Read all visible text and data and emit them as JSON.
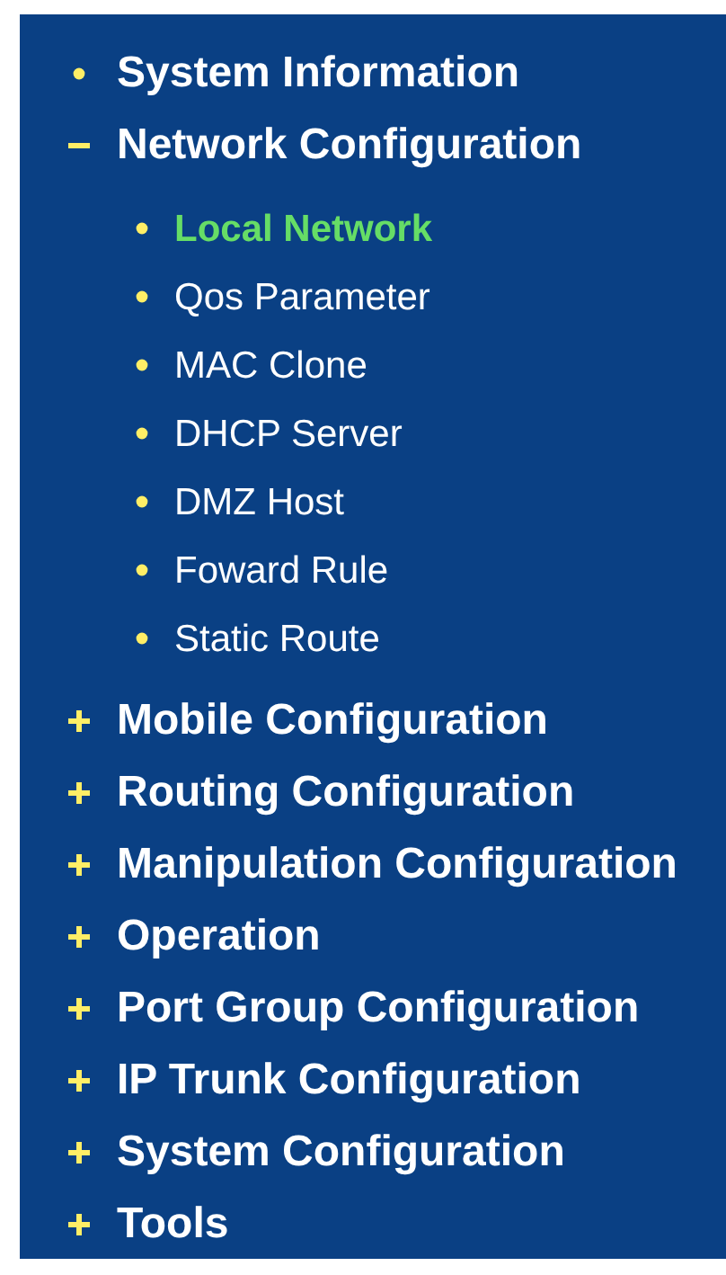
{
  "menu": {
    "items": [
      {
        "label": "System Information",
        "kind": "leaf",
        "selected": false
      },
      {
        "label": "Network Configuration",
        "kind": "group",
        "expanded": true,
        "selected": false,
        "children": [
          {
            "label": "Local Network",
            "selected": true
          },
          {
            "label": "Qos Parameter",
            "selected": false
          },
          {
            "label": "MAC Clone",
            "selected": false
          },
          {
            "label": "DHCP Server",
            "selected": false
          },
          {
            "label": "DMZ Host",
            "selected": false
          },
          {
            "label": "Foward Rule",
            "selected": false
          },
          {
            "label": "Static Route",
            "selected": false
          }
        ]
      },
      {
        "label": "Mobile Configuration",
        "kind": "group",
        "expanded": false,
        "selected": false
      },
      {
        "label": "Routing Configuration",
        "kind": "group",
        "expanded": false,
        "selected": false
      },
      {
        "label": "Manipulation Configuration",
        "kind": "group",
        "expanded": false,
        "selected": false
      },
      {
        "label": "Operation",
        "kind": "group",
        "expanded": false,
        "selected": false
      },
      {
        "label": "Port Group Configuration",
        "kind": "group",
        "expanded": false,
        "selected": false
      },
      {
        "label": "IP Trunk Configuration",
        "kind": "group",
        "expanded": false,
        "selected": false
      },
      {
        "label": "System Configuration",
        "kind": "group",
        "expanded": false,
        "selected": false
      },
      {
        "label": "Tools",
        "kind": "group",
        "expanded": false,
        "selected": false
      }
    ]
  }
}
